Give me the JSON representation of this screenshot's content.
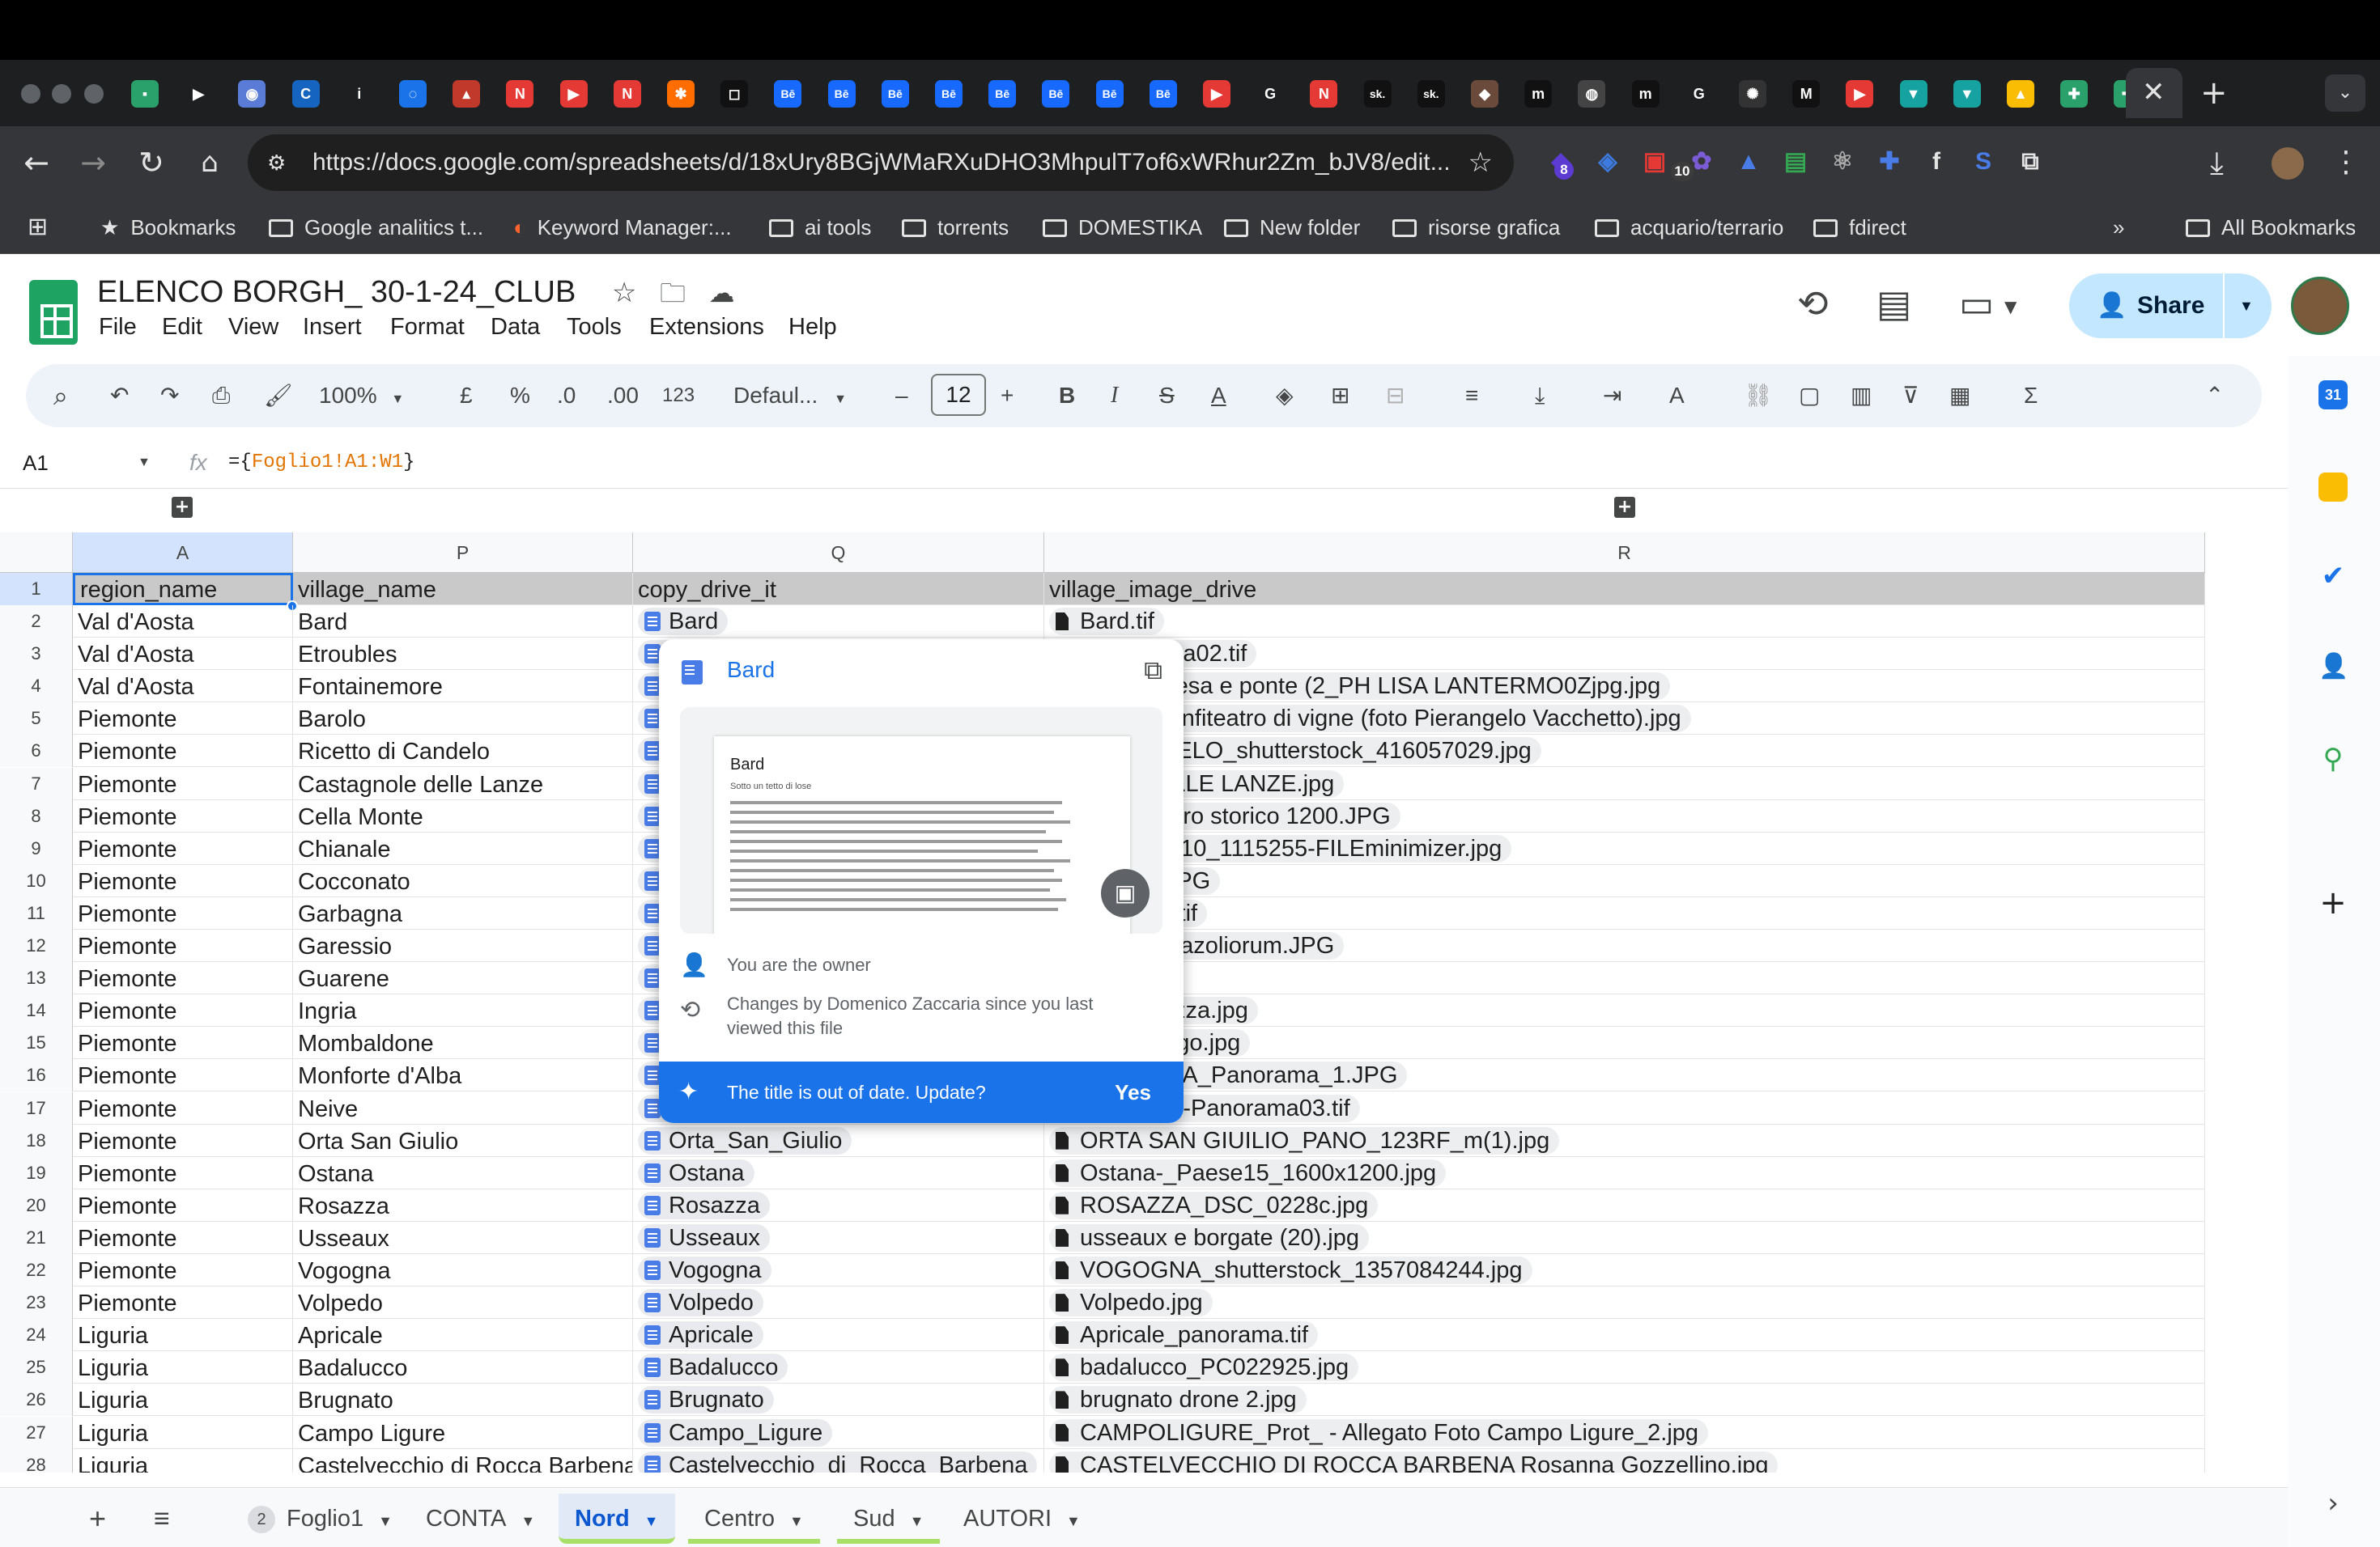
{
  "browser": {
    "url": "https://docs.google.com/spreadsheets/d/18xUry8BGjWMaRXuDHO3MhpulT7of6xWRhur2Zm_bJV8/edit...",
    "extension_badges": [
      "8",
      "10"
    ],
    "bookmarks": [
      {
        "label": "Bookmarks",
        "icon": "star-icon"
      },
      {
        "label": "Google analitics t...",
        "icon": "folder-icon"
      },
      {
        "label": "Keyword Manager:...",
        "icon": "semrush-icon"
      },
      {
        "label": "ai tools",
        "icon": "folder-icon"
      },
      {
        "label": "torrents",
        "icon": "folder-icon"
      },
      {
        "label": "DOMESTIKA",
        "icon": "folder-icon"
      },
      {
        "label": "New folder",
        "icon": "folder-icon"
      },
      {
        "label": "risorse grafica",
        "icon": "folder-icon"
      },
      {
        "label": "acquario/terrario",
        "icon": "folder-icon"
      },
      {
        "label": "fdirect",
        "icon": "folder-icon"
      }
    ],
    "bookmarks_more": "»",
    "all_bookmarks": "All Bookmarks"
  },
  "sheet": {
    "title": "ELENCO BORGH_ 30-1-24_CLUB",
    "menu": [
      "File",
      "Edit",
      "View",
      "Insert",
      "Format",
      "Data",
      "Tools",
      "Extensions",
      "Help"
    ],
    "share_label": "Share",
    "toolbar": {
      "zoom": "100%",
      "currency": "£",
      "percent": "%",
      "dec_decrease": ".0",
      "dec_increase": ".00",
      "number_format": "123",
      "font": "Defaul...",
      "font_size": "12"
    },
    "name_box": "A1",
    "formula_prefix": "={",
    "formula_ref": "Foglio1!A1:W1",
    "formula_suffix": "}",
    "columns": [
      "A",
      "P",
      "Q",
      "R"
    ],
    "header_row": [
      "region_name",
      "village_name",
      "copy_drive_it",
      "village_image_drive"
    ],
    "rows": [
      {
        "n": "2",
        "region": "Val d'Aosta",
        "village": "Bard",
        "doc": "Bard",
        "image": "Bard.tif"
      },
      {
        "n": "3",
        "region": "Val d'Aosta",
        "village": "Etroubles",
        "doc": "",
        "image": "-Panorama02.tif"
      },
      {
        "n": "4",
        "region": "Val d'Aosta",
        "village": "Fontainemore",
        "doc": "",
        "image": "more Chiesa e ponte (2_PH LISA LANTERMO0Zjpg.jpg"
      },
      {
        "n": "5",
        "region": "Piemonte",
        "village": "Barolo",
        "doc": "",
        "image": "_Barolo Anfiteatro di vigne (foto Pierangelo Vacchetto).jpg"
      },
      {
        "n": "6",
        "region": "Piemonte",
        "village": "Ricetto di Candelo",
        "doc": "",
        "image": "DI CANDELO_shutterstock_416057029.jpg"
      },
      {
        "n": "7",
        "region": "Piemonte",
        "village": "Castagnole delle Lanze",
        "doc": "",
        "image": "IOLE DELLE LANZE.jpg"
      },
      {
        "n": "8",
        "region": "Piemonte",
        "village": "Cella Monte",
        "doc": "",
        "image": "nte - Centro storico 1200.JPG"
      },
      {
        "n": "9",
        "region": "Piemonte",
        "village": "Chianale",
        "doc": "",
        "image": "E 20210810_1115255-FILEminimizer.jpg"
      },
      {
        "n": "10",
        "region": "Piemonte",
        "village": "Cocconato",
        "doc": "",
        "image": "o_0076.JPG"
      },
      {
        "n": "11",
        "region": "Piemonte",
        "village": "Garbagna",
        "doc": "",
        "image": "NA_apra.tif"
      },
      {
        "n": "12",
        "region": "Piemonte",
        "village": "Garessio",
        "doc": "",
        "image": "_Porta_Liazoliorum.JPG"
      },
      {
        "n": "13",
        "region": "Piemonte",
        "village": "Guarene",
        "doc": "",
        "image": "E1.jpg"
      },
      {
        "n": "14",
        "region": "Piemonte",
        "village": "Ingria",
        "doc": "",
        "image": "O)_-_Piazza.jpg"
      },
      {
        "n": "15",
        "region": "Piemonte",
        "village": "Mombaldone",
        "doc": "",
        "image": "done-Borgo.jpg"
      },
      {
        "n": "16",
        "region": "Piemonte",
        "village": "Monforte d'Alba",
        "doc": "",
        "image": "TE D'ALBA_Panorama_1.JPG"
      },
      {
        "n": "17",
        "region": "Piemonte",
        "village": "Neive",
        "doc": "",
        "image": "TE_Neive-Panorama03.tif"
      },
      {
        "n": "18",
        "region": "Piemonte",
        "village": "Orta San Giulio",
        "doc": "Orta_San_Giulio",
        "image": "ORTA SAN GIUILIO_PANO_123RF_m(1).jpg"
      },
      {
        "n": "19",
        "region": "Piemonte",
        "village": "Ostana",
        "doc": "Ostana",
        "image": "Ostana-_Paese15_1600x1200.jpg"
      },
      {
        "n": "20",
        "region": "Piemonte",
        "village": "Rosazza",
        "doc": "Rosazza",
        "image": "ROSAZZA_DSC_0228c.jpg"
      },
      {
        "n": "21",
        "region": "Piemonte",
        "village": "Usseaux",
        "doc": "Usseaux",
        "image": "usseaux e borgate (20).jpg"
      },
      {
        "n": "22",
        "region": "Piemonte",
        "village": "Vogogna",
        "doc": "Vogogna",
        "image": "VOGOGNA_shutterstock_1357084244.jpg"
      },
      {
        "n": "23",
        "region": "Piemonte",
        "village": "Volpedo",
        "doc": "Volpedo",
        "image": "Volpedo.jpg"
      },
      {
        "n": "24",
        "region": "Liguria",
        "village": "Apricale",
        "doc": "Apricale",
        "image": "Apricale_panorama.tif"
      },
      {
        "n": "25",
        "region": "Liguria",
        "village": "Badalucco",
        "doc": "Badalucco",
        "image": "badalucco_PC022925.jpg"
      },
      {
        "n": "26",
        "region": "Liguria",
        "village": "Brugnato",
        "doc": "Brugnato",
        "image": "brugnato drone 2.jpg"
      },
      {
        "n": "27",
        "region": "Liguria",
        "village": "Campo Ligure",
        "doc": "Campo_Ligure",
        "image": "CAMPOLIGURE_Prot_ - Allegato Foto Campo Ligure_2.jpg"
      },
      {
        "n": "28",
        "region": "Liguria",
        "village": "Castelvecchio di Rocca Barbena",
        "doc": "Castelvecchio_di_Rocca_Barbena",
        "image": "CASTELVECCHIO DI ROCCA BARBENA Rosanna Gozzellino.jpg"
      }
    ],
    "tabs": [
      {
        "label": "Foglio1",
        "badge": "2",
        "active": false
      },
      {
        "label": "CONTA",
        "active": false
      },
      {
        "label": "Nord",
        "active": true
      },
      {
        "label": "Centro",
        "active": false
      },
      {
        "label": "Sud",
        "active": false
      },
      {
        "label": "AUTORI",
        "active": false
      }
    ]
  },
  "hovercard": {
    "title": "Bard",
    "preview_title": "Bard",
    "preview_subtitle": "Sotto un tetto di lose",
    "owner_text": "You are the owner",
    "changes_text": "Changes by Domenico Zaccaria since you last viewed this file",
    "banner_text": "The title is out of date. Update?",
    "banner_action": "Yes"
  },
  "colors": {
    "sheets_green": "#1ea362",
    "share_bg": "#c2e7ff",
    "link_blue": "#1a73e8",
    "header_row_bg": "#c9c9c9"
  }
}
